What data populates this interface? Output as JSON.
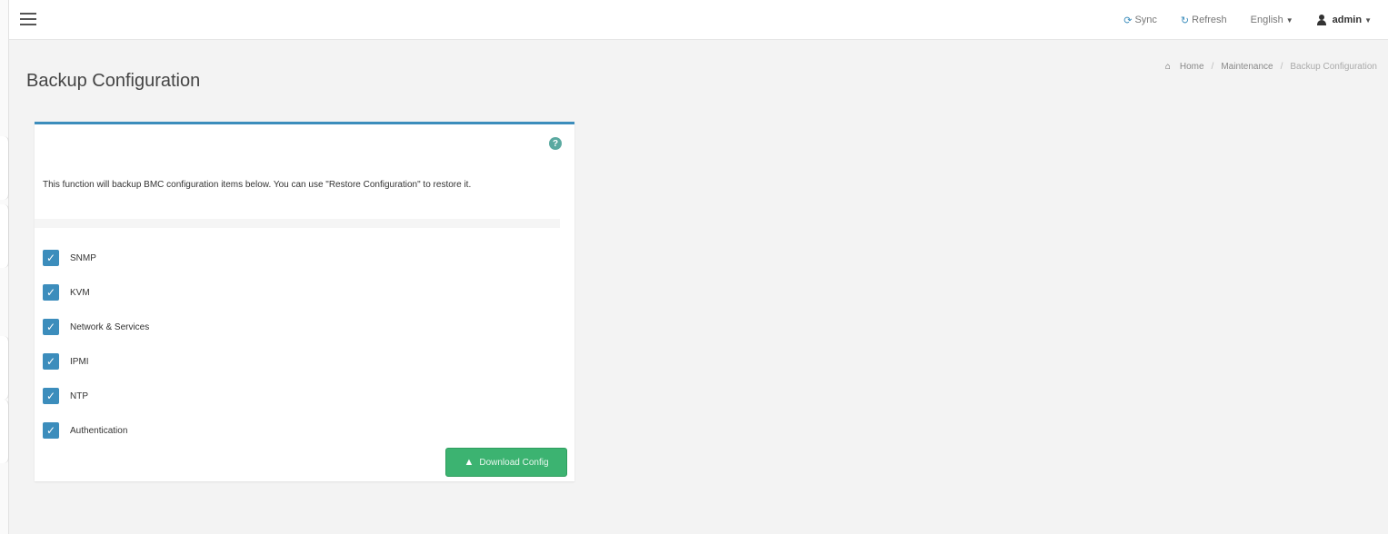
{
  "topbar": {
    "menu_icon": "hamburger-icon",
    "sync_label": "Sync",
    "refresh_label": "Refresh",
    "language_label": "English",
    "user_label": "admin"
  },
  "page": {
    "title": "Backup Configuration"
  },
  "breadcrumb": {
    "home": "Home",
    "section": "Maintenance",
    "current": "Backup Configuration"
  },
  "backup_box": {
    "description": "This function will backup BMC configuration items below. You can use \"Restore Configuration\" to restore it.",
    "items": [
      {
        "label": "SNMP",
        "checked": true
      },
      {
        "label": "KVM",
        "checked": true
      },
      {
        "label": "Network & Services",
        "checked": true
      },
      {
        "label": "IPMI",
        "checked": true
      },
      {
        "label": "NTP",
        "checked": true
      },
      {
        "label": "Authentication",
        "checked": true
      }
    ],
    "download_label": "Download Config"
  },
  "colors": {
    "accent": "#3c8dbc",
    "success": "#3cb371",
    "background": "#f3f3f3"
  }
}
